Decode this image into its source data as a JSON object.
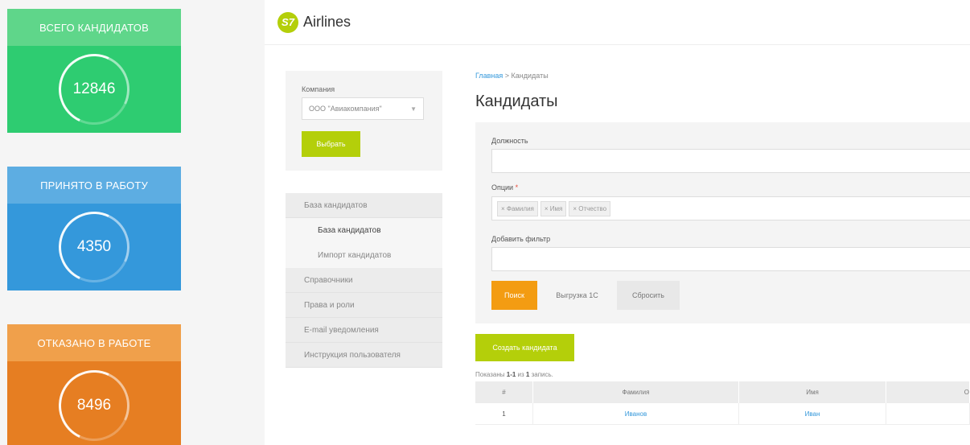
{
  "stats": [
    {
      "title": "ВСЕГО КАНДИДАТОВ",
      "value": "12846"
    },
    {
      "title": "ПРИНЯТО В РАБОТУ",
      "value": "4350"
    },
    {
      "title": "ОТКАЗАНО В РАБОТЕ",
      "value": "8496"
    }
  ],
  "header": {
    "logo_mark": "S7",
    "logo_text": "Airlines"
  },
  "company": {
    "label": "Компания",
    "selected": "ООО \"Авиакомпания\"",
    "button": "Выбрать"
  },
  "menu": {
    "items": [
      "База кандидатов",
      "База кандидатов",
      "Импорт кандидатов",
      "Справочники",
      "Права и роли",
      "E-mail уведомления",
      "Инструкция пользователя"
    ]
  },
  "breadcrumb": {
    "home": "Главная",
    "sep": " > ",
    "current": "Кандидаты"
  },
  "page_title": "Кандидаты",
  "filters": {
    "position_label": "Должность",
    "options_label": "Опции",
    "required_mark": "*",
    "tags": [
      "× Фамилия",
      "× Имя",
      "× Отчество"
    ],
    "add_filter_label": "Добавить фильтр",
    "search_btn": "Поиск",
    "export_btn": "Выгрузка 1С",
    "reset_btn": "Сбросить"
  },
  "create_btn": "Создать кандидата",
  "shown": {
    "prefix": "Показаны ",
    "range": "1-1",
    "mid": " из ",
    "total": "1",
    "suffix": " запись."
  },
  "table": {
    "headers": [
      "#",
      "Фамилия",
      "Имя",
      "О"
    ],
    "rows": [
      [
        "1",
        "Иванов",
        "Иван",
        ""
      ]
    ]
  },
  "colors": {
    "lime": "#b4cf0a",
    "orange": "#f39c12",
    "green": "#2ecc71",
    "blue": "#3498db",
    "deep_orange": "#e67e22"
  }
}
